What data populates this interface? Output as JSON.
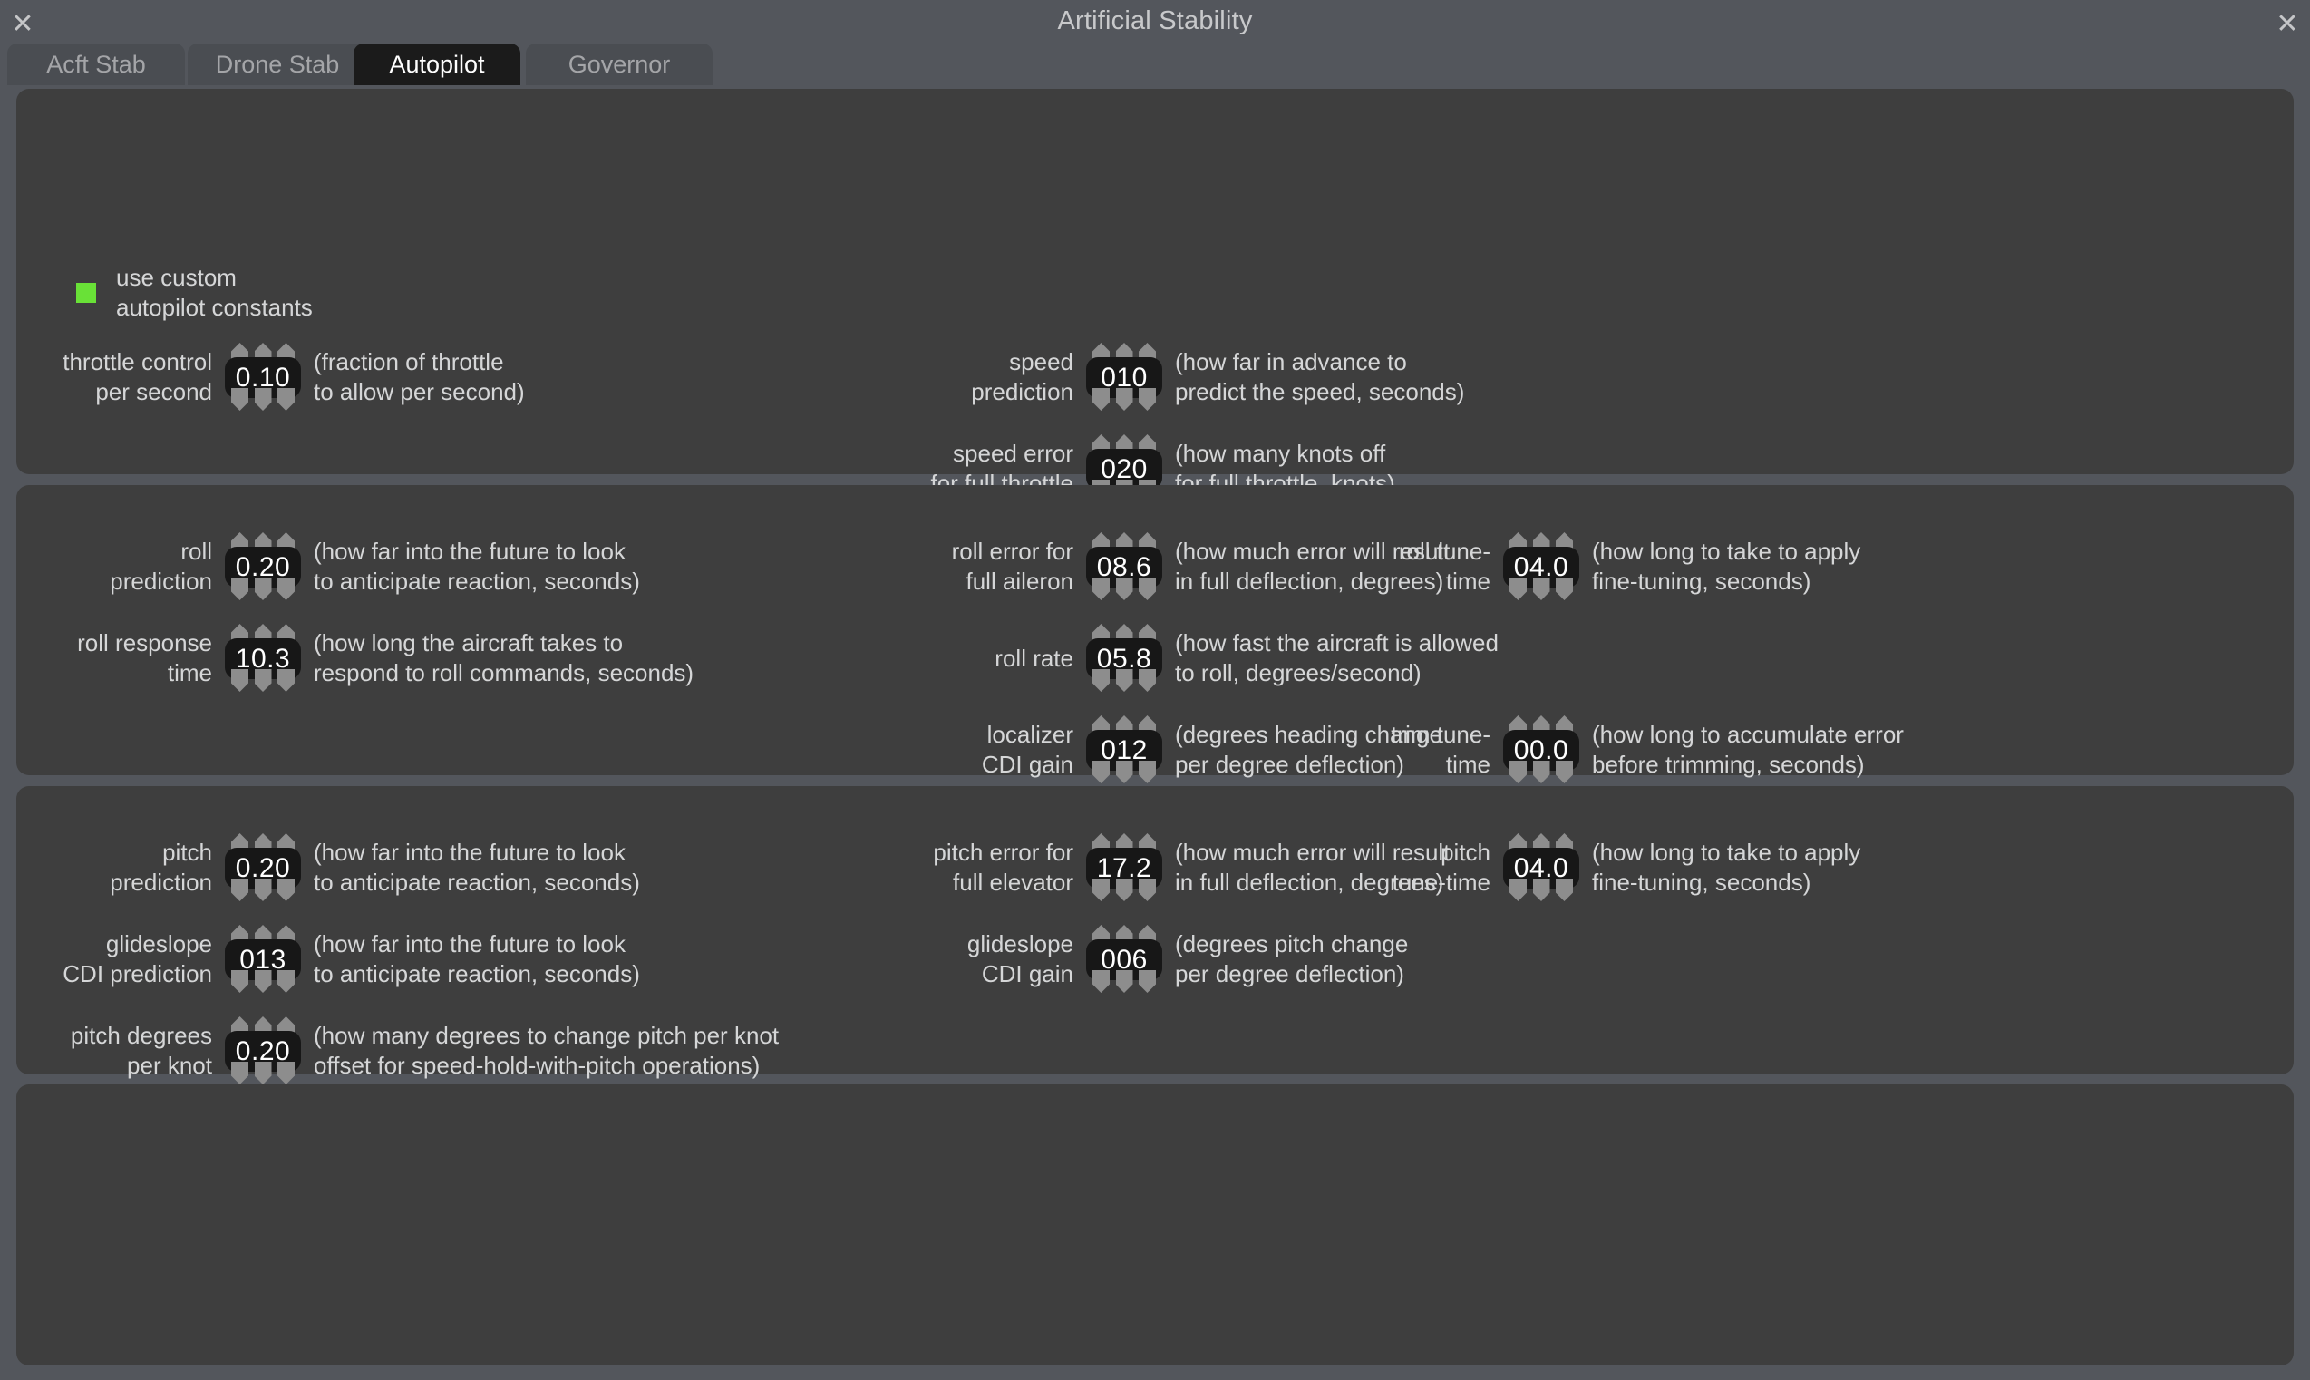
{
  "window": {
    "title": "Artificial Stability",
    "close_glyph": "✕"
  },
  "tabs": [
    {
      "label": "Acft Stab",
      "active": false
    },
    {
      "label": "Drone Stab",
      "active": false
    },
    {
      "label": "Autopilot",
      "active": true
    },
    {
      "label": "Governor",
      "active": false
    }
  ],
  "colors": {
    "window_bg": "#53565c",
    "panel_bg": "#3e3e3e",
    "tab_active_bg": "#1b1b1b",
    "tab_inactive_bg": "#4a4d52",
    "text": "#d5d6d7",
    "value_pill_bg": "#171717",
    "checkbox_on": "#69e137",
    "arrow": "#8d8d8d"
  },
  "checkbox": {
    "name": "use-custom-autopilot-constants",
    "checked": true,
    "label": "use custom\nautopilot constants"
  },
  "panels": [
    {
      "name": "throttle-speed-panel",
      "fields": [
        {
          "name": "throttle-control-per-second",
          "label": "throttle control\nper second",
          "value": "0.10",
          "help": "(fraction of throttle\nto allow per second)",
          "col": 0,
          "row": 0
        },
        {
          "name": "speed-prediction",
          "label": "speed\nprediction",
          "value": "010",
          "help": "(how far in advance to\npredict the speed, seconds)",
          "col": 1,
          "row": 0
        },
        {
          "name": "speed-error-for-full-throttle",
          "label": "speed error\nfor full throttle",
          "value": "020",
          "help": "(how many knots off\nfor full throttle, knots)",
          "col": 1,
          "row": 1
        }
      ]
    },
    {
      "name": "roll-panel",
      "fields": [
        {
          "name": "roll-prediction",
          "label": "roll\nprediction",
          "value": "0.20",
          "help": "(how far into the future to look\nto anticipate reaction, seconds)",
          "col": 0,
          "row": 0
        },
        {
          "name": "roll-response-time",
          "label": "roll response\ntime",
          "value": "10.3",
          "help": "(how long the aircraft takes to\nrespond to roll commands, seconds)",
          "col": 0,
          "row": 1
        },
        {
          "name": "roll-error-for-full-aileron",
          "label": "roll error for\nfull aileron",
          "value": "08.6",
          "help": "(how much error will result\nin full deflection, degrees)",
          "col": 1,
          "row": 0
        },
        {
          "name": "roll-rate",
          "label": "roll rate",
          "value": "05.8",
          "help": "(how fast the aircraft is allowed\nto roll, degrees/second)",
          "col": 1,
          "row": 1
        },
        {
          "name": "localizer-cdi-gain",
          "label": "localizer\nCDI gain",
          "value": "012",
          "help": "(degrees heading change\nper degree deflection)",
          "col": 1,
          "row": 2
        },
        {
          "name": "roll-tune-time",
          "label": "roll tune-\ntime",
          "value": "04.0",
          "help": "(how long to take to apply\nfine-tuning, seconds)",
          "col": 2,
          "row": 0
        },
        {
          "name": "trim-tune-time",
          "label": "trim tune-\ntime",
          "value": "00.0",
          "help": "(how long to accumulate error\nbefore trimming, seconds)",
          "col": 2,
          "row": 2
        }
      ]
    },
    {
      "name": "pitch-panel",
      "fields": [
        {
          "name": "pitch-prediction",
          "label": "pitch\nprediction",
          "value": "0.20",
          "help": "(how far into the future to look\nto anticipate reaction, seconds)",
          "col": 0,
          "row": 0
        },
        {
          "name": "glideslope-cdi-prediction",
          "label": "glideslope\nCDI prediction",
          "value": "013",
          "help": "(how far into the future to look\nto anticipate reaction, seconds)",
          "col": 0,
          "row": 1
        },
        {
          "name": "pitch-degrees-per-knot",
          "label": "pitch degrees\nper knot",
          "value": "0.20",
          "help": "(how many degrees to change pitch per knot\noffset for speed-hold-with-pitch operations)",
          "col": 0,
          "row": 2
        },
        {
          "name": "pitch-error-for-full-elevator",
          "label": "pitch error for\nfull elevator",
          "value": "17.2",
          "help": "(how much error will result\nin full deflection, degrees)",
          "col": 1,
          "row": 0
        },
        {
          "name": "glideslope-cdi-gain",
          "label": "glideslope\nCDI gain",
          "value": "006",
          "help": "(degrees pitch change\nper degree deflection)",
          "col": 1,
          "row": 1
        },
        {
          "name": "pitch-tune-time",
          "label": "pitch\ntune-time",
          "value": "04.0",
          "help": "(how long to take to apply\nfine-tuning, seconds)",
          "col": 2,
          "row": 0
        }
      ]
    },
    {
      "name": "empty-panel",
      "fields": []
    }
  ]
}
